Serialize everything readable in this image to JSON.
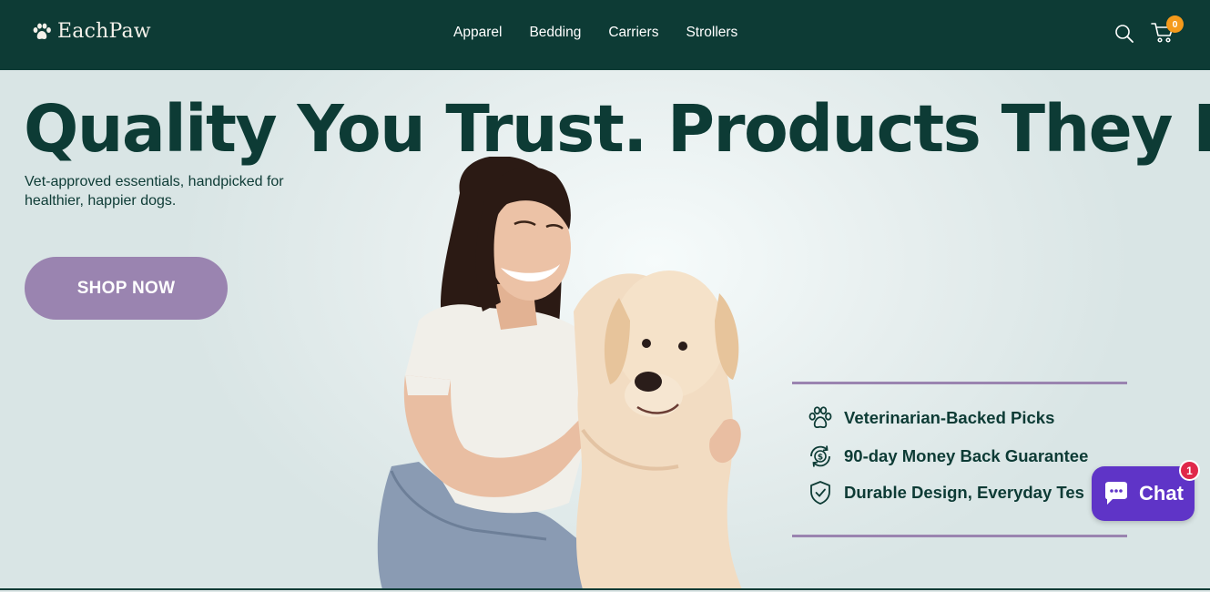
{
  "header": {
    "logo_text": "EachPaw",
    "nav": [
      "Apparel",
      "Bedding",
      "Carriers",
      "Strollers"
    ],
    "cart_count": "0",
    "icons": [
      "paw-logo-icon",
      "search-icon",
      "cart-icon"
    ]
  },
  "hero": {
    "headline": "Quality You Trust. Products They Love.",
    "subcopy": "Vet-approved essentials, handpicked for healthier, happier dogs.",
    "cta_label": "SHOP NOW",
    "features": [
      {
        "icon": "paw-icon",
        "label": "Veterinarian-Backed Picks"
      },
      {
        "icon": "money-back-icon",
        "label": "90-day Money Back Guarantee"
      },
      {
        "icon": "shield-check-icon",
        "label": "Durable Design, Everyday Tes"
      }
    ]
  },
  "chat": {
    "label": "Chat",
    "badge": "1"
  },
  "colors": {
    "header_bg": "#0d3b35",
    "accent_purple": "#9a84b0",
    "cart_badge": "#f59a1b",
    "chat_bg": "#5f34c7",
    "chat_badge": "#e0284a"
  }
}
